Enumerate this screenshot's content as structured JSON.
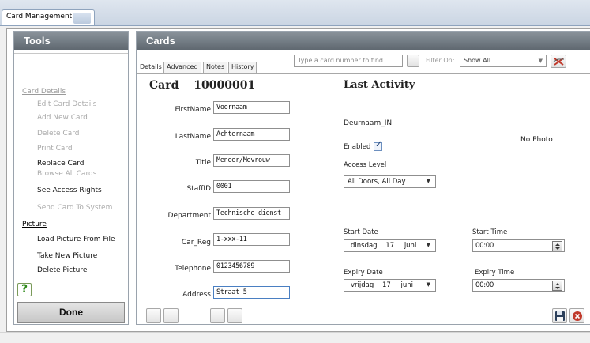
{
  "window": {
    "title": "Card Management"
  },
  "tools": {
    "header": "Tools",
    "card_section": "Card Details",
    "card_items": [
      {
        "label": "Edit Card Details",
        "enabled": false
      },
      {
        "label": "Add New Card",
        "enabled": false
      },
      {
        "label": "Delete Card",
        "enabled": false
      },
      {
        "label": "Print Card",
        "enabled": false
      },
      {
        "label": "Replace Card",
        "enabled": true
      },
      {
        "label": "Browse All Cards",
        "enabled": false
      },
      {
        "label": "See Access Rights",
        "enabled": true
      },
      {
        "label": "Send Card To System",
        "enabled": false
      }
    ],
    "picture_section": "Picture",
    "picture_items": [
      {
        "label": "Load Picture From File",
        "enabled": true
      },
      {
        "label": "Take New Picture",
        "enabled": true
      },
      {
        "label": "Delete Picture",
        "enabled": true
      }
    ],
    "help_glyph": "?",
    "done_label": "Done"
  },
  "cards": {
    "header": "Cards",
    "tabs": [
      "Details",
      "Advanced",
      "Notes",
      "History"
    ],
    "active_tab": "Details",
    "search_placeholder": "Type a card number to find",
    "filter_label": "Filter On:",
    "filter_value": "Show All",
    "card_label": "Card",
    "card_number": "10000001",
    "fields": {
      "firstname": {
        "label": "FirstName",
        "value": "Voornaam"
      },
      "lastname": {
        "label": "LastName",
        "value": "Achternaam"
      },
      "title": {
        "label": "Title",
        "value": "Meneer/Mevrouw"
      },
      "staffid": {
        "label": "StaffID",
        "value": "0001"
      },
      "department": {
        "label": "Department",
        "value": "Technische dienst"
      },
      "car_reg": {
        "label": "Car_Reg",
        "value": "1-xxx-11"
      },
      "telephone": {
        "label": "Telephone",
        "value": "0123456789"
      },
      "address": {
        "label": "Address",
        "value": "Straat 5"
      }
    },
    "last_activity": {
      "heading": "Last Activity",
      "value": "Deurnaam_IN",
      "enabled_label": "Enabled",
      "enabled": true,
      "access_level_label": "Access Level",
      "access_level_value": "All Doors, All Day",
      "photo_text": "No Photo"
    },
    "dates": {
      "start_date_label": "Start Date",
      "start_date": {
        "weekday": "dinsdag",
        "day": "17",
        "month": "juni"
      },
      "start_time_label": "Start Time",
      "start_time": "00:00",
      "expiry_date_label": "Expiry Date",
      "expiry_date": {
        "weekday": "vrijdag",
        "day": "17",
        "month": "juni"
      },
      "expiry_time_label": "Expiry Time",
      "expiry_time": "00:00"
    }
  },
  "icons": {
    "help": "help-icon",
    "clear_filter": "clear-filter-icon",
    "save": "floppy-disk-icon",
    "cancel": "cancel-icon",
    "spinner": "spinner-icon"
  }
}
